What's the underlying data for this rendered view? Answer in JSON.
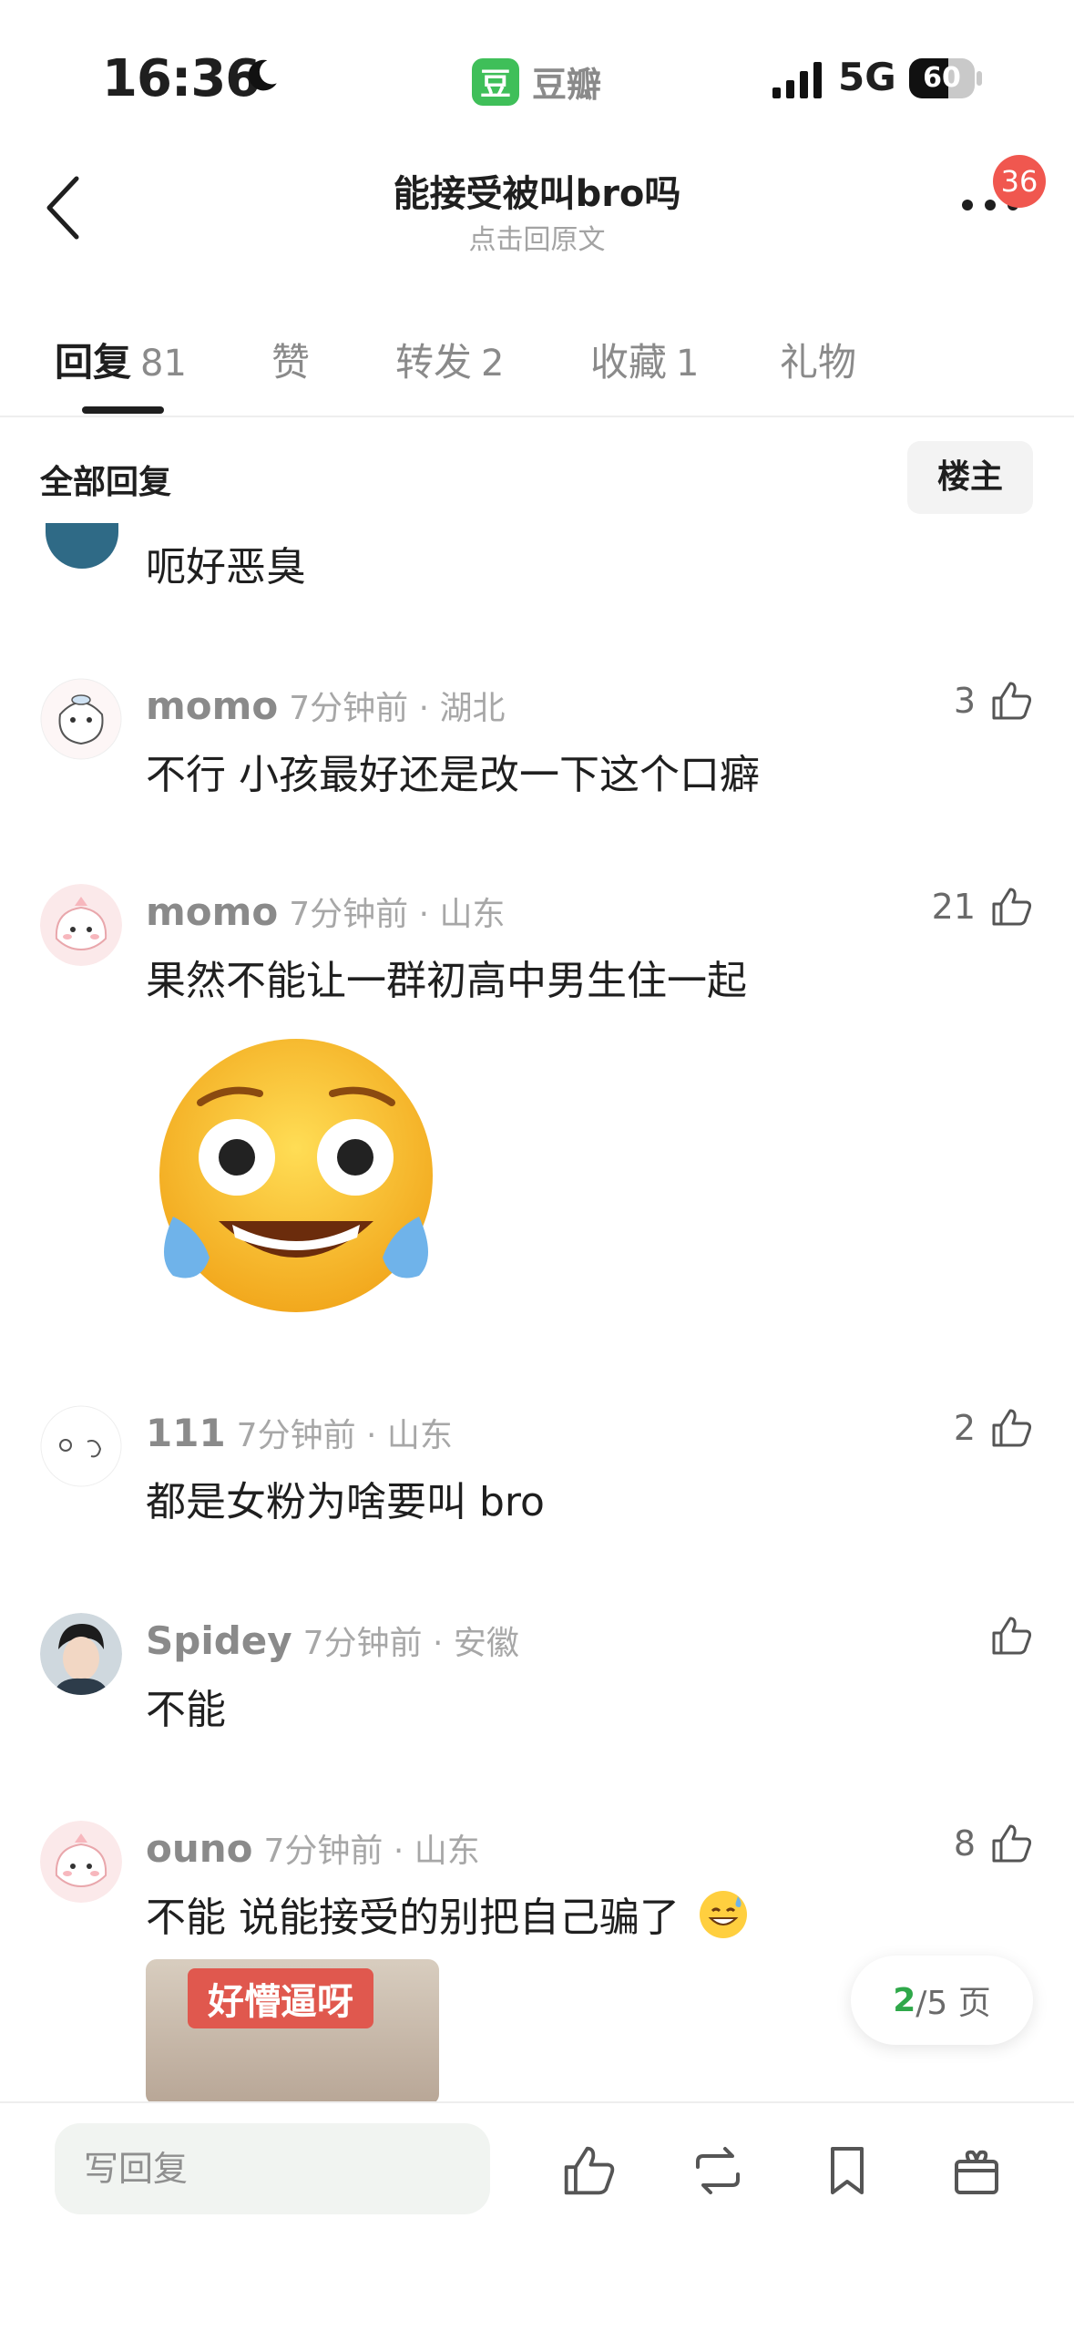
{
  "status_bar": {
    "time": "16:36",
    "network": "5G",
    "battery_label": "60",
    "battery_level": 0.6
  },
  "app": {
    "logo_char": "豆",
    "name": "豆瓣"
  },
  "header": {
    "title": "能接受被叫bro吗",
    "subtitle": "点击回原文",
    "badge_count": "36"
  },
  "tabs": [
    {
      "label": "回复",
      "count": "81"
    },
    {
      "label": "赞",
      "count": ""
    },
    {
      "label": "转发",
      "count": "2"
    },
    {
      "label": "收藏",
      "count": "1"
    },
    {
      "label": "礼物",
      "count": ""
    }
  ],
  "filter": {
    "title": "全部回复",
    "op_button": "楼主"
  },
  "comments": [
    {
      "author": "",
      "time_loc": "",
      "likes": "",
      "text": "呃好恶臭"
    },
    {
      "author": "momo",
      "time_loc": "7分钟前 · 湖北",
      "likes": "3",
      "text": "不行 小孩最好还是改一下这个口癖"
    },
    {
      "author": "momo",
      "time_loc": "7分钟前 · 山东",
      "likes": "21",
      "text": "果然不能让一群初高中男生住一起"
    },
    {
      "author": "111",
      "time_loc": "7分钟前 · 山东",
      "likes": "2",
      "text": "都是女粉为啥要叫 bro"
    },
    {
      "author": "Spidey",
      "time_loc": "7分钟前 · 安徽",
      "likes": "",
      "text": "不能"
    },
    {
      "author": "ouno",
      "time_loc": "7分钟前 · 山东",
      "likes": "8",
      "text": "不能 说能接受的别把自己骗了",
      "image_caption": "好懵逼呀"
    }
  ],
  "pagination": {
    "current": "2",
    "total_text": "/5 页"
  },
  "bottom_bar": {
    "reply_placeholder": "写回复"
  },
  "colors": {
    "accent_green": "#2fa84a",
    "badge_red": "#f0574f",
    "douban_green": "#3fbf59"
  }
}
